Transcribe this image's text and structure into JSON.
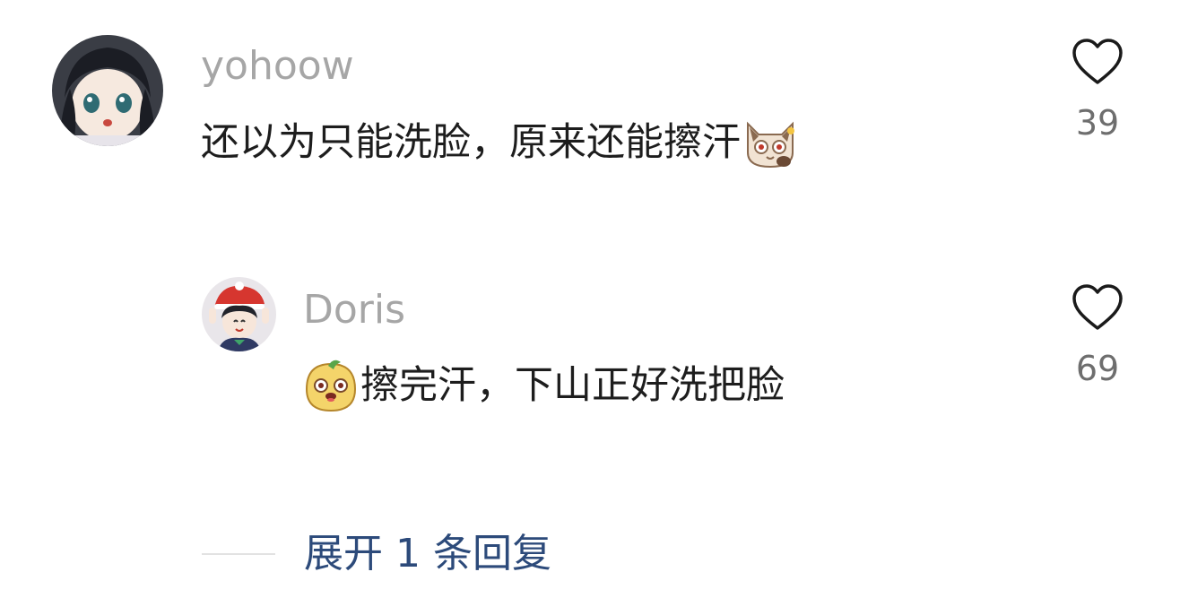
{
  "comments": {
    "main": {
      "username": "yohoow",
      "text": "还以为只能洗脸，原来还能擦汗",
      "emoji": "cat-emoji",
      "likes": "39",
      "avatar": "anime-girl-avatar"
    },
    "reply": {
      "username": "Doris",
      "text": "擦完汗，下山正好洗把脸",
      "emoji": "blob-face-emoji",
      "likes": "69",
      "avatar": "santa-hat-anime-avatar"
    }
  },
  "expand": {
    "label": "展开 1 条回复"
  },
  "icons": {
    "like": "heart-outline-icon"
  },
  "colors": {
    "username": "#a6a6a6",
    "text": "#1d1d1d",
    "count": "#6e6e6e",
    "link": "#2c4a7a"
  }
}
